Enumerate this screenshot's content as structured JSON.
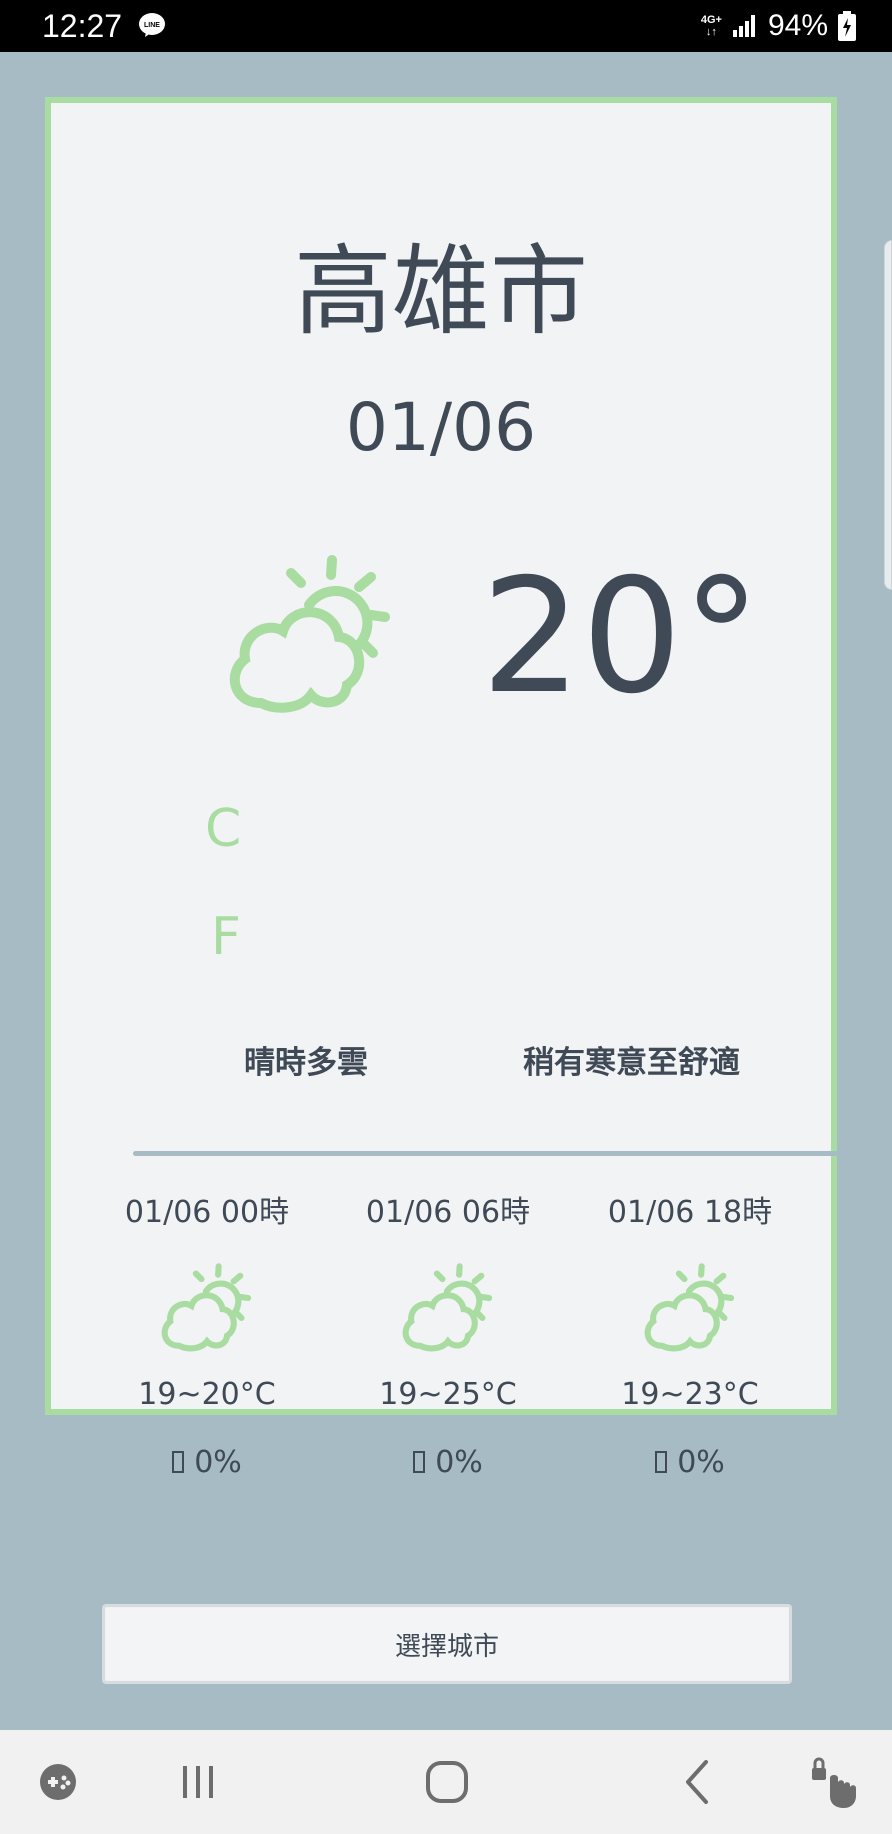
{
  "status_bar": {
    "time": "12:27",
    "network_top": "4G+",
    "network_bottom": "↓↑",
    "battery": "94%"
  },
  "weather": {
    "city": "高雄市",
    "date": "01/06",
    "temperature": "20°",
    "unit_c": "C",
    "unit_f": "F",
    "description": "晴時多雲",
    "comfort": "稍有寒意至舒適",
    "icon": "partly-cloudy-day-icon",
    "accent_color": "#a9dca0"
  },
  "forecast": [
    {
      "time": "01/06 00時",
      "temp_range": "19~20°C",
      "rain": "0%",
      "icon": "partly-cloudy-day-icon"
    },
    {
      "time": "01/06 06時",
      "temp_range": "19~25°C",
      "rain": "0%",
      "icon": "partly-cloudy-day-icon"
    },
    {
      "time": "01/06 18時",
      "temp_range": "19~23°C",
      "rain": "0%",
      "icon": "partly-cloudy-day-icon"
    }
  ],
  "select_city_label": "選擇城市",
  "colors": {
    "background": "#a6bbc3",
    "card": "#f1f3f5",
    "text": "#3f4a56"
  }
}
